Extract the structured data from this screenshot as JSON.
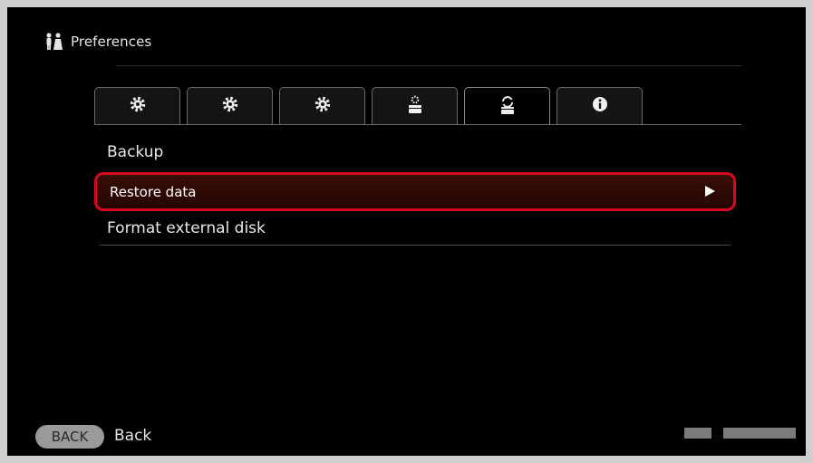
{
  "header": {
    "title": "Preferences",
    "icon": "preferences-people-icon"
  },
  "tabs": [
    {
      "icon": "settings-1-icon",
      "active": false
    },
    {
      "icon": "settings-2-icon",
      "active": false
    },
    {
      "icon": "settings-3-icon",
      "active": false
    },
    {
      "icon": "drive-settings-icon",
      "active": false
    },
    {
      "icon": "backup-restore-drive-icon",
      "active": true
    },
    {
      "icon": "info-icon",
      "active": false
    }
  ],
  "menu": {
    "items": [
      {
        "label": "Backup"
      },
      {
        "label": "Restore data",
        "selected": true
      },
      {
        "label": "Format external disk"
      }
    ]
  },
  "footer": {
    "back_button": "BACK",
    "back_label": "Back"
  },
  "colors": {
    "accent": "#d40b1e",
    "background": "#000000",
    "text": "#e8e8e8"
  }
}
